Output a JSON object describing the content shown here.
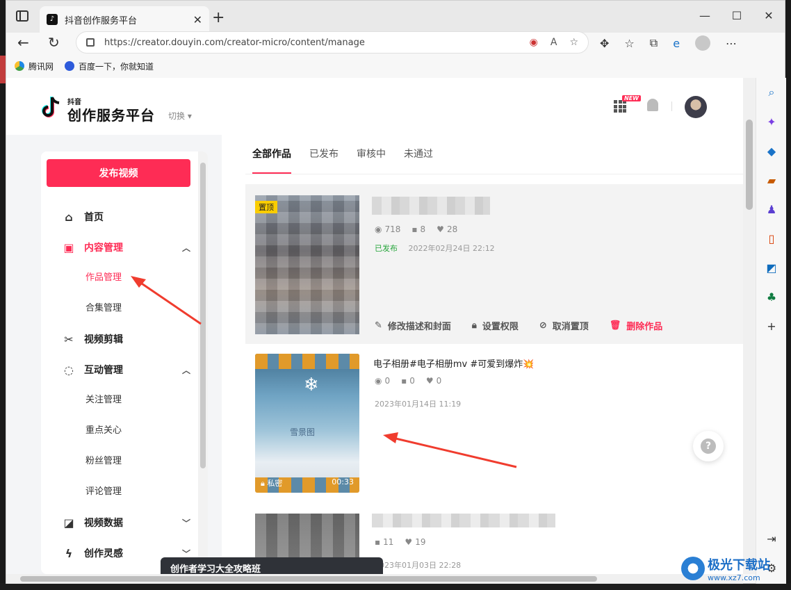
{
  "browser": {
    "tab_title": "抖音创作服务平台",
    "url": "https://creator.douyin.com/creator-micro/content/manage",
    "favorites": [
      {
        "label": "腾讯网"
      },
      {
        "label": "百度一下，你就知道"
      }
    ]
  },
  "header": {
    "logo_small": "抖音",
    "logo_text": "创作服务平台",
    "switch_label": "切换",
    "new_badge": "NEW"
  },
  "nav": {
    "publish_label": "发布视频",
    "items": [
      {
        "label": "首页",
        "icon": "home-icon"
      },
      {
        "label": "内容管理",
        "icon": "play-square-icon"
      },
      {
        "label": "作品管理"
      },
      {
        "label": "合集管理"
      },
      {
        "label": "视频剪辑",
        "icon": "scissors-icon"
      },
      {
        "label": "互动管理",
        "icon": "chat-icon"
      },
      {
        "label": "关注管理"
      },
      {
        "label": "重点关心"
      },
      {
        "label": "粉丝管理"
      },
      {
        "label": "评论管理"
      },
      {
        "label": "视频数据",
        "icon": "chart-icon"
      },
      {
        "label": "创作灵感",
        "icon": "bolt-icon"
      }
    ]
  },
  "tabs": [
    "全部作品",
    "已发布",
    "审核中",
    "未通过"
  ],
  "works": [
    {
      "pin_badge": "置顶",
      "views": "718",
      "comments": "8",
      "likes": "28",
      "status": "已发布",
      "time": "2022年02月24日 22:12",
      "actions": {
        "edit": "修改描述和封面",
        "permission": "设置权限",
        "unpin": "取消置顶",
        "delete": "删除作品"
      }
    },
    {
      "title": "电子相册#电子相册mv #可爱到爆炸💥",
      "views": "0",
      "comments": "0",
      "likes": "0",
      "time": "2023年01月14日 11:19",
      "thumb_caption": "雪景图",
      "privacy": "私密",
      "duration": "00:33"
    },
    {
      "comments": "11",
      "likes": "19",
      "time": "2023年01月03日 22:28"
    }
  ],
  "toast": "创作者学习大全攻略班",
  "watermark": {
    "big": "极光下载站",
    "small": "www.xz7.com"
  },
  "colors": {
    "brand": "#fe2c55",
    "ok": "#25a53a",
    "pin": "#facd00"
  }
}
